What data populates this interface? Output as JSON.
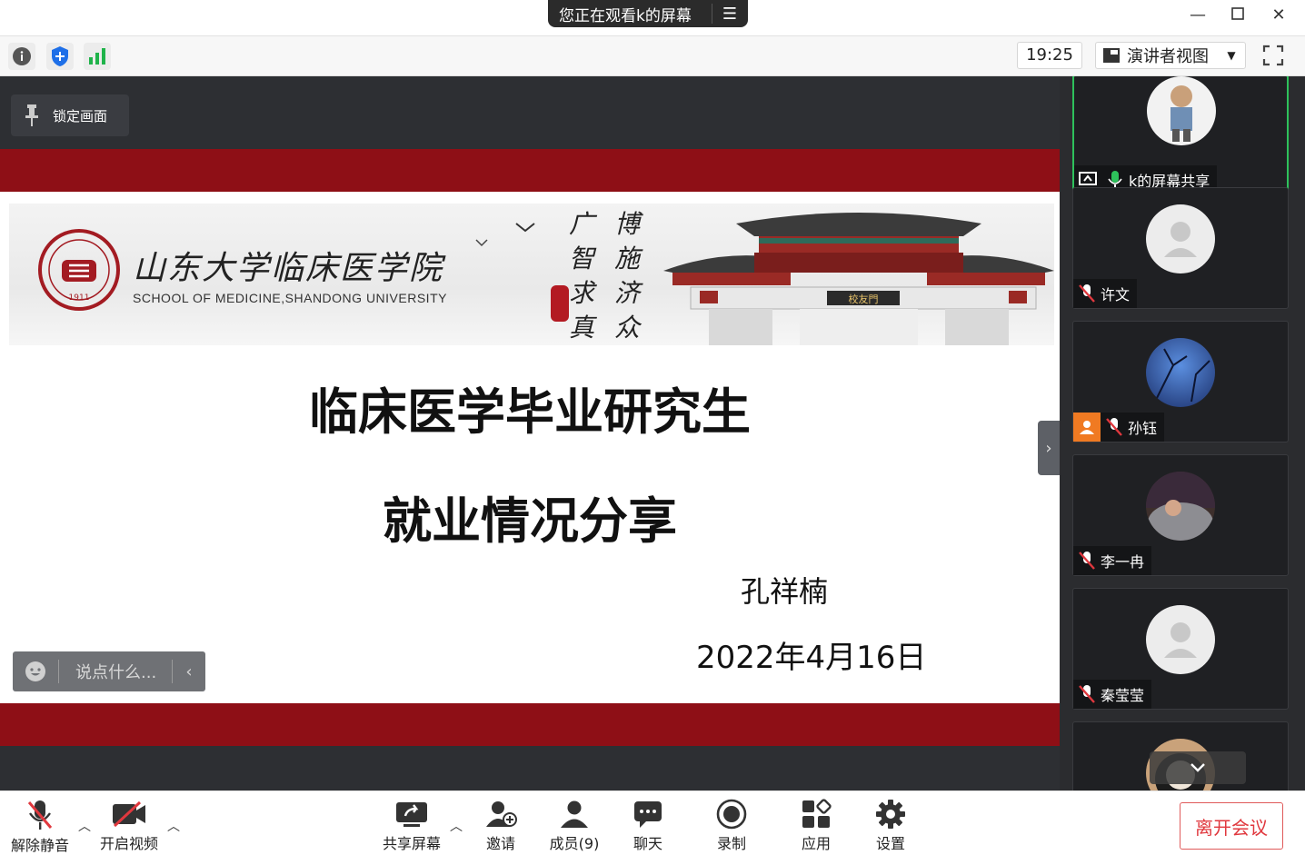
{
  "window": {
    "share_notice": "您正在观看k的屏幕",
    "menu_icon": "menu-icon",
    "controls": [
      "minimize-icon",
      "maximize-icon",
      "close-icon"
    ]
  },
  "toolbar": {
    "time": "19:25",
    "view_mode": "演讲者视图",
    "icons": [
      "info-icon",
      "shield-icon",
      "signal-icon",
      "fullscreen-icon"
    ]
  },
  "stage": {
    "lock_label": "锁定画面",
    "chat_placeholder": "说点什么..."
  },
  "slide": {
    "school_cn": "山东大学临床医学院",
    "school_en": "SCHOOL OF MEDICINE,SHANDONG UNIVERSITY",
    "seal_year": "1911",
    "motto_1": "广智求真",
    "motto_2": "博施济众",
    "gate_plaque": "校友門",
    "title": "临床医学毕业研究生",
    "subtitle": "就业情况分享",
    "author": "孔祥楠",
    "date": "2022年4月16日"
  },
  "participants": [
    {
      "name": "k的屏幕共享",
      "status": "speaking",
      "sharing": true
    },
    {
      "name": "许文",
      "status": "muted"
    },
    {
      "name": "孙钰",
      "status": "muted",
      "host_badge": true
    },
    {
      "name": "李一冉",
      "status": "muted"
    },
    {
      "name": "秦莹莹",
      "status": "muted"
    },
    {
      "name": "",
      "status": "muted"
    }
  ],
  "bottombar": {
    "unmute": "解除静音",
    "video": "开启视频",
    "share": "共享屏幕",
    "invite": "邀请",
    "members": "成员(9)",
    "chat": "聊天",
    "record": "录制",
    "apps": "应用",
    "settings": "设置",
    "leave": "离开会议"
  },
  "colors": {
    "accent_red": "#8e0f16",
    "leave_red": "#e0383e",
    "active_green": "#2ec15b",
    "sidebar_bg": "#2b2c2f"
  }
}
